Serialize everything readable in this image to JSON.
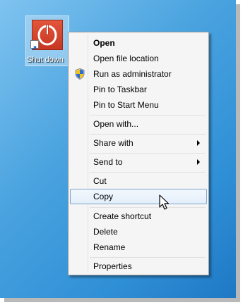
{
  "desktop": {
    "icon_label": "Shut down",
    "icon_name": "power-icon",
    "colors": {
      "tile": "#d4452c",
      "selection": "#bbdef6"
    }
  },
  "context_menu": {
    "hover_item": "Copy",
    "items": [
      {
        "label": "Open",
        "bold": true
      },
      {
        "label": "Open file location"
      },
      {
        "label": "Run as administrator",
        "icon": "uac-shield-icon"
      },
      {
        "label": "Pin to Taskbar"
      },
      {
        "label": "Pin to Start Menu"
      },
      {
        "label": "Open with..."
      },
      {
        "label": "Share with",
        "submenu": true
      },
      {
        "label": "Send to",
        "submenu": true
      },
      {
        "label": "Cut"
      },
      {
        "label": "Copy"
      },
      {
        "label": "Create shortcut"
      },
      {
        "label": "Delete"
      },
      {
        "label": "Rename"
      },
      {
        "label": "Properties"
      }
    ]
  }
}
